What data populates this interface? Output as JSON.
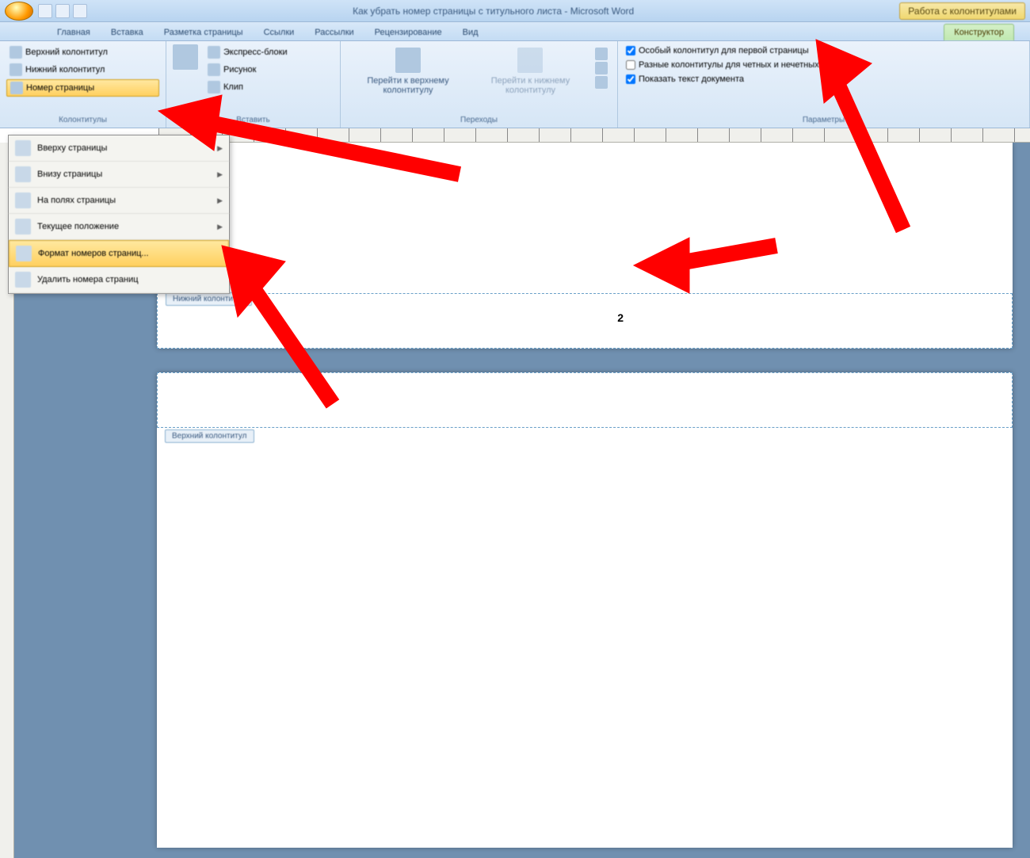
{
  "title": "Как убрать номер страницы с титульного листа - Microsoft Word",
  "context_title": "Работа с колонтитулами",
  "tabs": [
    "Главная",
    "Вставка",
    "Разметка страницы",
    "Ссылки",
    "Рассылки",
    "Рецензирование",
    "Вид"
  ],
  "context_tab": "Конструктор",
  "ribbon": {
    "g1": {
      "items": [
        "Верхний колонтитул",
        "Нижний колонтитул",
        "Номер страницы"
      ],
      "label": "Колонтитулы"
    },
    "g2": {
      "items": [
        "Экспресс-блоки",
        "Рисунок",
        "Клип"
      ],
      "label": "Вставить"
    },
    "g3": {
      "nav1": "Перейти к верхнему\nколонтитулу",
      "nav2": "Перейти к нижнему\nколонтитулу",
      "label": "Переходы"
    },
    "g4": {
      "chk1": "Особый колонтитул для первой страницы",
      "chk2": "Разные колонтитулы для четных и нечетных страниц",
      "chk3": "Показать текст документа",
      "label": "Параметры"
    }
  },
  "dropdown": {
    "items": [
      {
        "label": "Вверху страницы",
        "arrow": true
      },
      {
        "label": "Внизу страницы",
        "arrow": true
      },
      {
        "label": "На полях страницы",
        "arrow": true
      },
      {
        "label": "Текущее положение",
        "arrow": true
      },
      {
        "label": "Формат номеров страниц...",
        "arrow": false,
        "hl": true
      },
      {
        "label": "Удалить номера страниц",
        "arrow": false
      }
    ]
  },
  "footer_tag": "Нижний колонтитул",
  "header_tag": "Верхний колонтитул",
  "page_number": "2"
}
